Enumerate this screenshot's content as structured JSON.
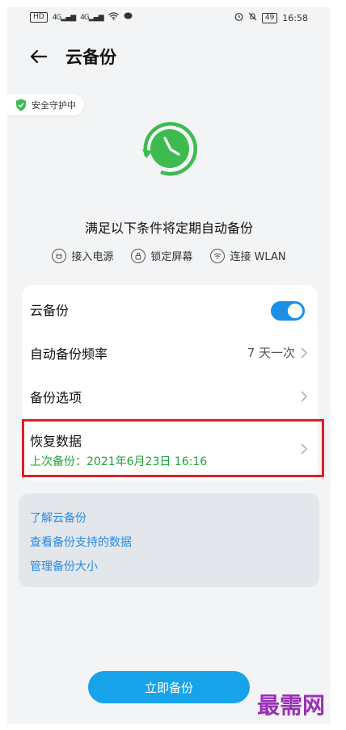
{
  "status_bar": {
    "left_hd": "HD",
    "left_sig1": "4G",
    "left_sig2": "4G",
    "battery": "49",
    "time": "16:58"
  },
  "header": {
    "title": "云备份"
  },
  "security_badge": {
    "label": "安全守护中"
  },
  "backup_conditions": {
    "title": "满足以下条件将定期自动备份",
    "items": [
      {
        "label": "接入电源",
        "icon": "plug-icon"
      },
      {
        "label": "锁定屏幕",
        "icon": "lock-icon"
      },
      {
        "label": "连接 WLAN",
        "icon": "wifi-icon"
      }
    ]
  },
  "settings": {
    "cloud_backup_label": "云备份",
    "cloud_backup_enabled": true,
    "frequency_label": "自动备份频率",
    "frequency_value": "7 天一次",
    "options_label": "备份选项",
    "restore_label": "恢复数据",
    "last_backup": "上次备份：2021年6月23日 16:16"
  },
  "links": [
    "了解云备份",
    "查看备份支持的数据",
    "管理备份大小"
  ],
  "backup_now_label": "立即备份",
  "watermark": "最需网",
  "colors": {
    "accent_blue": "#17a3ea",
    "toggle_blue": "#1b8fe8",
    "green": "#3dbb4f",
    "link_blue": "#2a8be0",
    "highlight_red": "#e01e25"
  }
}
